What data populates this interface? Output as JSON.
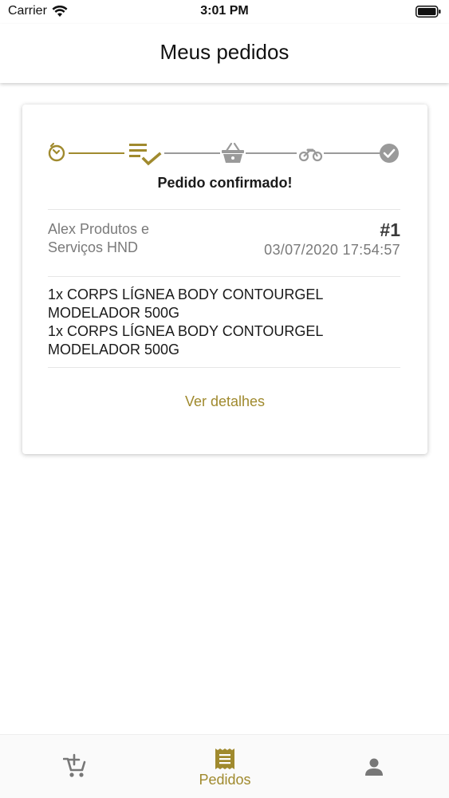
{
  "status_bar": {
    "carrier": "Carrier",
    "time": "3:01 PM"
  },
  "header": {
    "title": "Meus pedidos"
  },
  "order": {
    "tracker_steps": [
      {
        "icon": "clock-icon",
        "state": "completed"
      },
      {
        "icon": "list-check-icon",
        "state": "current"
      },
      {
        "icon": "basket-icon",
        "state": "pending"
      },
      {
        "icon": "motorcycle-icon",
        "state": "pending"
      },
      {
        "icon": "check-circle-icon",
        "state": "pending"
      }
    ],
    "status_text": "Pedido confirmado!",
    "store_name": "Alex Produtos e Serviços HND",
    "number": "#1",
    "date": "03/07/2020 17:54:57",
    "items": [
      "1x CORPS LÍGNEA BODY CONTOURGEL MODELADOR 500G",
      "1x CORPS LÍGNEA BODY CONTOURGEL MODELADOR 500G"
    ],
    "details_label": "Ver detalhes"
  },
  "tab_bar": {
    "tabs": [
      {
        "icon": "cart-add-icon",
        "label": "",
        "active": false
      },
      {
        "icon": "receipt-icon",
        "label": "Pedidos",
        "active": true
      },
      {
        "icon": "person-icon",
        "label": "",
        "active": false
      }
    ]
  },
  "colors": {
    "accent": "#a08a2e",
    "inactive": "#888888",
    "text": "#1a1a1a"
  }
}
